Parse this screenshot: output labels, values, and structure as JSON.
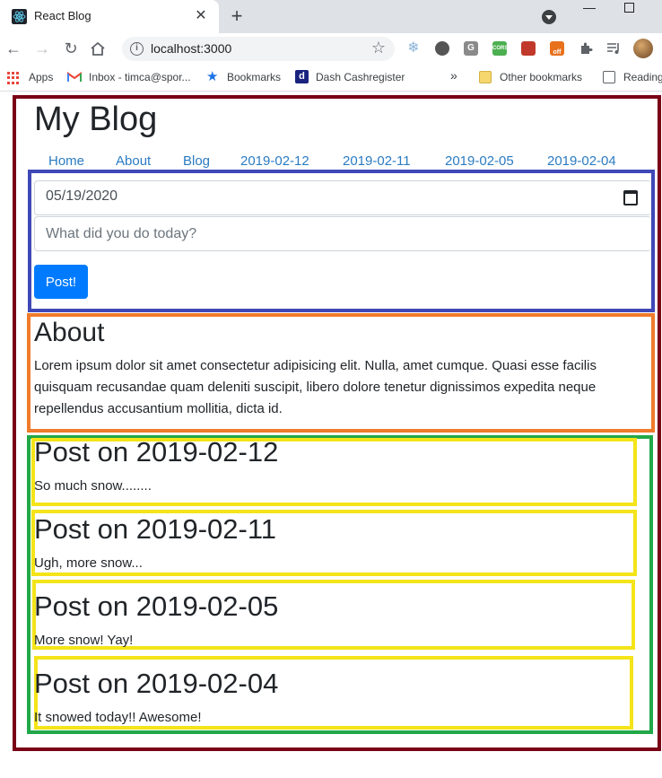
{
  "browser": {
    "tab_title": "React Blog",
    "tab_close": "✕",
    "new_tab": "+",
    "url": "localhost:3000",
    "window_minimize": "—",
    "extensions": {
      "cors_label": "CORS",
      "off_label": "off",
      "g_label": "G"
    },
    "bookmarks": {
      "apps": "Apps",
      "inbox": "Inbox - timca@spor...",
      "bookmarks": "Bookmarks",
      "dash": "Dash Cashregister",
      "overflow": "»",
      "other": "Other bookmarks",
      "reading": "Reading"
    }
  },
  "site": {
    "title": "My Blog",
    "nav": [
      "Home",
      "About",
      "Blog",
      "2019-02-12",
      "2019-02-11",
      "2019-02-05",
      "2019-02-04"
    ]
  },
  "form": {
    "date_value": "05/19/2020",
    "text_placeholder": "What did you do today?",
    "submit_label": "Post!"
  },
  "about": {
    "title": "About",
    "text": "Lorem ipsum dolor sit amet consectetur adipisicing elit. Nulla, amet cumque. Quasi esse facilis quisquam recusandae quam deleniti suscipit, libero dolore tenetur dignissimos expedita neque repellendus accusantium mollitia, dicta id."
  },
  "posts": [
    {
      "title": "Post on 2019-02-12",
      "body": "So much snow........"
    },
    {
      "title": "Post on 2019-02-11",
      "body": "Ugh, more snow..."
    },
    {
      "title": "Post on 2019-02-05",
      "body": "More snow! Yay!"
    },
    {
      "title": "Post on 2019-02-04",
      "body": "It snowed today!! Awesome!"
    }
  ],
  "colors": {
    "frame_outer": "#7a0016",
    "frame_form": "#3e48b6",
    "frame_about": "#f07b2b",
    "frame_posts": "#22a848",
    "frame_post": "#f4e418",
    "link": "#2a7bc2",
    "button": "#007bff"
  }
}
